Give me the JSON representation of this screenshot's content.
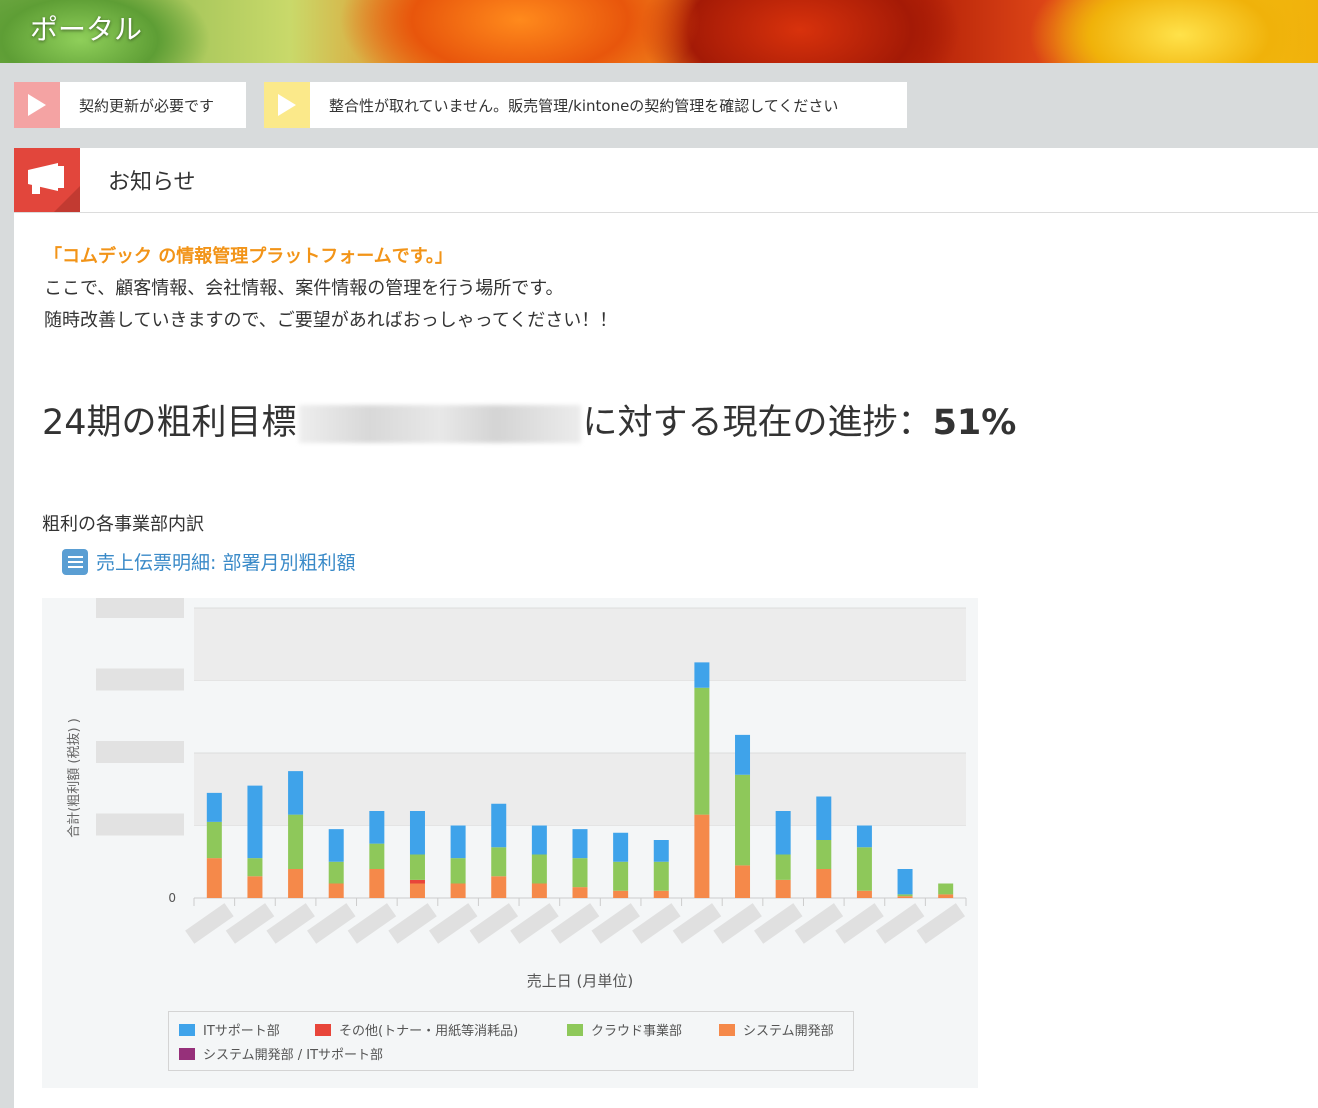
{
  "header": {
    "title": "ポータル"
  },
  "alerts": [
    {
      "text": "契約更新が必要です",
      "color": "#f4a3a3"
    },
    {
      "text": "整合性が取れていません。販売管理/kintoneの契約管理を確認してください",
      "color": "#fbe98a"
    }
  ],
  "notice": {
    "title": "お知らせ",
    "lead": "「コムデック の情報管理プラットフォームです。」",
    "lines": [
      "ここで、顧客情報、会社情報、案件情報の管理を行う場所です。",
      "随時改善していきますので、ご要望があればおっしゃってください！！"
    ],
    "progress_prefix": "24期の粗利目標",
    "progress_suffix": "に対する現在の進捗：",
    "progress_value": "51%",
    "section_label": "粗利の各事業部内訳",
    "report_link": "売上伝票明細: 部署月別粗利額"
  },
  "chart_data": {
    "type": "bar",
    "stacked": true,
    "xlabel": "売上日 (月単位)",
    "ylabel": "合計(粗利額 (税抜) )",
    "y_ticks": [
      "0"
    ],
    "categories_hidden": true,
    "series": [
      {
        "name": "ITサポート部",
        "color": "#3fa3ea",
        "values": [
          8,
          20,
          12,
          9,
          9,
          12,
          9,
          12,
          8,
          8,
          8,
          6,
          7,
          11,
          12,
          12,
          6,
          7,
          0
        ]
      },
      {
        "name": "その他(トナー・用紙等消耗品)",
        "color": "#e8453a",
        "values": [
          0,
          0,
          0,
          0,
          0,
          1,
          0,
          0,
          0,
          0,
          0,
          0,
          0,
          0,
          0,
          0,
          0,
          0,
          0
        ]
      },
      {
        "name": "クラウド事業部",
        "color": "#8ec85a",
        "values": [
          10,
          5,
          15,
          6,
          7,
          7,
          7,
          8,
          8,
          8,
          8,
          8,
          35,
          25,
          7,
          8,
          12,
          0.5,
          3
        ]
      },
      {
        "name": "システム開発部",
        "color": "#f5894a",
        "values": [
          11,
          6,
          8,
          4,
          8,
          4,
          4,
          6,
          4,
          3,
          2,
          2,
          23,
          9,
          5,
          8,
          2,
          0.5,
          1
        ]
      },
      {
        "name": "システム開発部 / ITサポート部",
        "color": "#96307a",
        "values": [
          0,
          0,
          0,
          0,
          0,
          0,
          0,
          0,
          0,
          0,
          0,
          0,
          0,
          0,
          0,
          0,
          0,
          0,
          0
        ]
      }
    ],
    "y_max": 80,
    "grid": true,
    "legend_position": "bottom"
  }
}
